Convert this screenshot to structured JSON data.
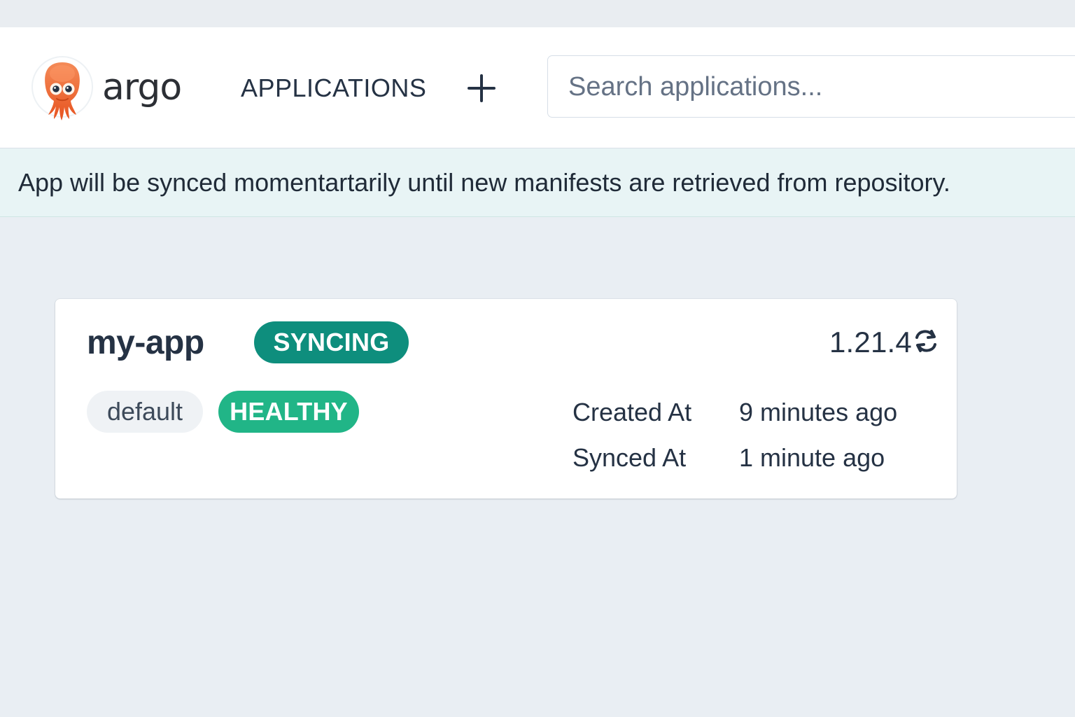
{
  "colors": {
    "background": "#e9eef3",
    "header_background": "#ffffff",
    "notice_background": "#e8f4f5",
    "text": "#253244",
    "logo_orange": "#f26a2b",
    "sync_badge": "#0e8e7d",
    "healthy_badge": "#21b587",
    "project_tag": "#eff2f5"
  },
  "header": {
    "brand": "argo",
    "logo_icon": "argo-octopus-logo",
    "nav_label": "APPLICATIONS",
    "add_icon": "plus-icon",
    "search": {
      "value": "",
      "placeholder": "Search applications..."
    }
  },
  "notice": {
    "text": "App will be synced momentartarily until new manifests are retrieved from repository."
  },
  "application": {
    "name": "my-app",
    "sync_status": "SYNCING",
    "version": "1.21.4",
    "refresh_icon": "refresh-icon",
    "project": "default",
    "health_status": "HEALTHY",
    "details": {
      "created_label": "Created At",
      "created_value": "9 minutes ago",
      "synced_label": "Synced At",
      "synced_value": "1 minute ago"
    }
  }
}
